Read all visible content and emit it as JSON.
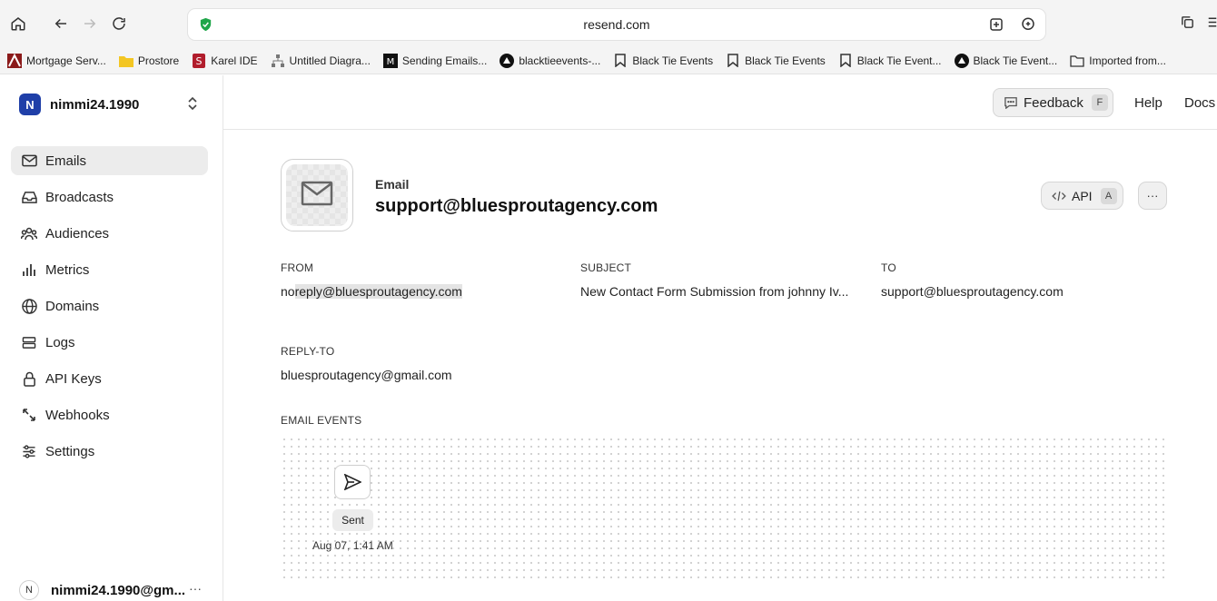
{
  "browser": {
    "url": "resend.com",
    "bookmarks": [
      {
        "label": "Mortgage Serv...",
        "icon": "mortgage-icon"
      },
      {
        "label": "Prostore",
        "icon": "folder-icon"
      },
      {
        "label": "Karel IDE",
        "icon": "karel-icon"
      },
      {
        "label": "Untitled Diagra...",
        "icon": "diagram-icon"
      },
      {
        "label": "Sending Emails...",
        "icon": "medium-icon"
      },
      {
        "label": "blacktieevents-...",
        "icon": "triangle-icon"
      },
      {
        "label": "Black Tie Events",
        "icon": "bookmark-icon"
      },
      {
        "label": "Black Tie Events",
        "icon": "bookmark-icon"
      },
      {
        "label": "Black Tie Event...",
        "icon": "bookmark-icon"
      },
      {
        "label": "Black Tie Event...",
        "icon": "triangle-icon"
      },
      {
        "label": "Imported from...",
        "icon": "folder-icon"
      }
    ]
  },
  "sidebar": {
    "team_initial": "N",
    "team_name": "nimmi24.1990",
    "items": [
      {
        "label": "Emails",
        "icon": "mail-icon",
        "active": true
      },
      {
        "label": "Broadcasts",
        "icon": "inbox-icon"
      },
      {
        "label": "Audiences",
        "icon": "users-icon"
      },
      {
        "label": "Metrics",
        "icon": "bar-chart-icon"
      },
      {
        "label": "Domains",
        "icon": "globe-icon"
      },
      {
        "label": "Logs",
        "icon": "logs-icon"
      },
      {
        "label": "API Keys",
        "icon": "lock-icon"
      },
      {
        "label": "Webhooks",
        "icon": "webhook-icon"
      },
      {
        "label": "Settings",
        "icon": "sliders-icon"
      }
    ],
    "user_initial": "N",
    "user_email": "nimmi24.1990@gm...",
    "user_more": "···"
  },
  "header": {
    "feedback_label": "Feedback",
    "feedback_key": "F",
    "help_label": "Help",
    "docs_label": "Docs"
  },
  "email": {
    "type_label": "Email",
    "address": "support@bluesproutagency.com",
    "api_label": "API",
    "api_key": "A",
    "more_label": "···",
    "from_label": "FROM",
    "from_prefix": "no",
    "from_rest": "reply@bluesproutagency.com",
    "subject_label": "SUBJECT",
    "subject_value": "New Contact Form Submission from johnny Iv...",
    "to_label": "TO",
    "to_value": "support@bluesproutagency.com",
    "reply_to_label": "REPLY-TO",
    "reply_to_value": "bluesproutagency@gmail.com",
    "events_label": "EMAIL EVENTS",
    "events": [
      {
        "status": "Sent",
        "time": "Aug 07, 1:41 AM",
        "icon": "send-icon"
      }
    ]
  }
}
